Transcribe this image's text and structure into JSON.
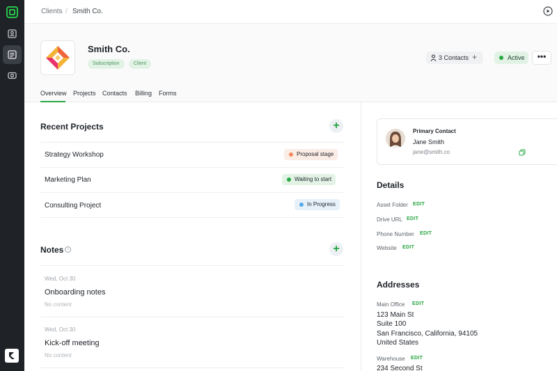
{
  "breadcrumb": {
    "root": "Clients",
    "separator": "/",
    "current": "Smith Co."
  },
  "client": {
    "name": "Smith Co.",
    "tags": [
      "Subscription",
      "Client"
    ]
  },
  "header_actions": {
    "contacts_label": "3 Contacts",
    "status_label": "Active",
    "more_label": "•••"
  },
  "tabs": [
    "Overview",
    "Projects",
    "Contacts",
    "Billing",
    "Forms"
  ],
  "recent_projects": {
    "title": "Recent Projects",
    "items": [
      {
        "name": "Strategy Workshop",
        "status": "Proposal stage",
        "status_color": "#f08a5d",
        "pill_bg": "#fbece5"
      },
      {
        "name": "Marketing Plan",
        "status": "Waiting to start",
        "status_color": "#27a844",
        "pill_bg": "#e2f3e6"
      },
      {
        "name": "Consulting Project",
        "status": "In Progress",
        "status_color": "#5aa9e6",
        "pill_bg": "#e6f1fa"
      }
    ]
  },
  "notes": {
    "title": "Notes",
    "items": [
      {
        "date": "Wed, Oct 30",
        "title": "Onboarding notes",
        "body": "No content"
      },
      {
        "date": "Wed, Oct 30",
        "title": "Kick-off meeting",
        "body": "No content"
      }
    ]
  },
  "primary_contact": {
    "label": "Primary Contact",
    "name": "Jane Smith",
    "email": "jane@smith.co"
  },
  "details": {
    "title": "Details",
    "edit_label": "EDIT",
    "fields": [
      "Asset Folder",
      "Drive URL",
      "Phone Number",
      "Website"
    ]
  },
  "addresses": {
    "title": "Addresses",
    "edit_label": "EDIT",
    "main_office": {
      "label": "Main Office",
      "lines": [
        "123 Main St",
        "Suite 100",
        "San Francisco, California, 94105",
        "United States"
      ]
    },
    "warehouse": {
      "label": "Warehouse",
      "lines": [
        "234 Second St"
      ]
    }
  },
  "colors": {
    "accent": "#27a844",
    "sidebar": "#1f2227"
  },
  "icons": [
    "app-logo-icon",
    "contacts-icon",
    "notes-icon",
    "camera-icon",
    "brand-icon",
    "play-icon",
    "person-icon",
    "plus-icon",
    "info-icon",
    "copy-icon"
  ]
}
